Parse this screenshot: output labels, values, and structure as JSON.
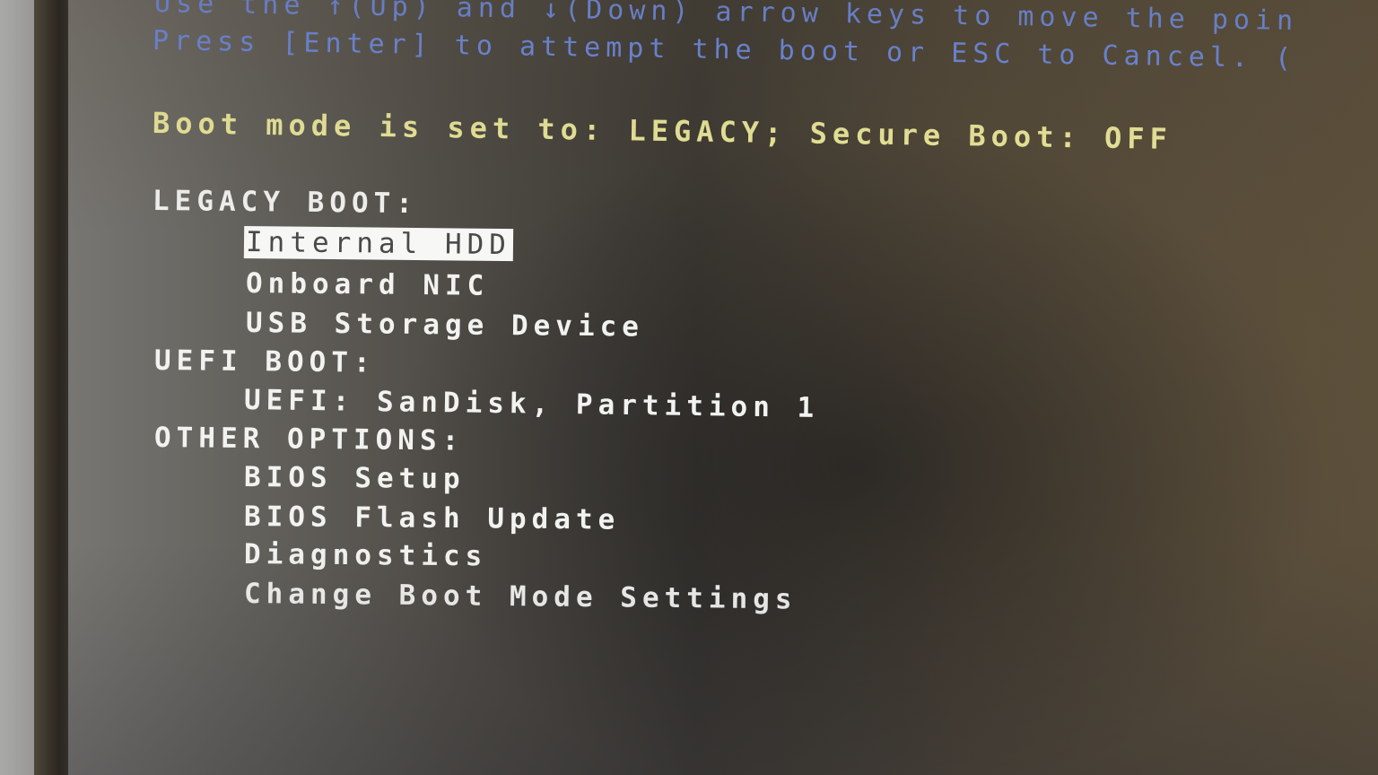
{
  "instructions": {
    "line1": "Use the ↑(Up) and ↓(Down) arrow keys to move the poin",
    "line2": "Press [Enter] to attempt the boot or ESC to Cancel. ("
  },
  "status": {
    "text": "Boot mode is set to: LEGACY; Secure Boot: OFF",
    "boot_mode": "LEGACY",
    "secure_boot": "OFF"
  },
  "sections": [
    {
      "heading": "LEGACY BOOT:",
      "items": [
        {
          "label": "Internal HDD",
          "selected": true
        },
        {
          "label": "Onboard NIC",
          "selected": false
        },
        {
          "label": "USB Storage Device",
          "selected": false
        }
      ]
    },
    {
      "heading": "UEFI BOOT:",
      "items": [
        {
          "label": "UEFI: SanDisk, Partition 1",
          "selected": false
        }
      ]
    },
    {
      "heading": "OTHER OPTIONS:",
      "items": [
        {
          "label": "BIOS Setup",
          "selected": false
        },
        {
          "label": "BIOS Flash Update",
          "selected": false
        },
        {
          "label": "Diagnostics",
          "selected": false
        },
        {
          "label": "Change Boot Mode Settings",
          "selected": false
        }
      ]
    }
  ],
  "colors": {
    "instruction_text": "#6f8ff0",
    "status_text": "#f1ee9e",
    "menu_text": "#f2f2f0",
    "selection_background": "#f7f7f5",
    "selection_text": "#4a4a4a"
  }
}
